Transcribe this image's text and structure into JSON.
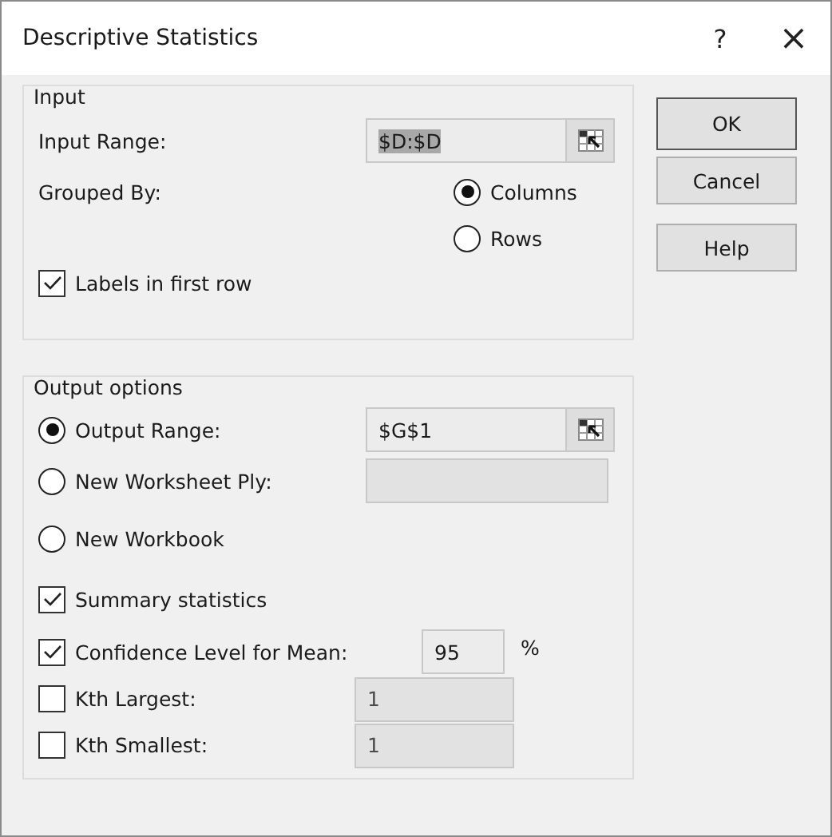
{
  "window": {
    "title": "Descriptive Statistics",
    "help": "?",
    "close": "×"
  },
  "input": {
    "title": "Input",
    "range_label": "Input Range:",
    "range_value": "$D:$D",
    "grouped_label": "Grouped By:",
    "grouping": [
      {
        "label": "Columns",
        "selected": true
      },
      {
        "label": "Rows",
        "selected": false
      }
    ],
    "labels_first_row": {
      "label": "Labels in first row",
      "checked": true
    }
  },
  "output": {
    "title": "Output options",
    "destinations": [
      {
        "label": "Output Range:",
        "selected": true,
        "kind": "range",
        "value": "$G$1"
      },
      {
        "label": "New Worksheet Ply:",
        "selected": false,
        "kind": "text"
      },
      {
        "label": "New Workbook",
        "selected": false,
        "kind": "none"
      }
    ],
    "options": [
      {
        "label": "Summary statistics",
        "checked": true,
        "kind": "plain"
      },
      {
        "label": "Confidence Level for Mean:",
        "checked": true,
        "kind": "percent",
        "value": "95",
        "unit": "%"
      },
      {
        "label": "Kth Largest:",
        "checked": false,
        "kind": "number",
        "value": "1"
      },
      {
        "label": "Kth Smallest:",
        "checked": false,
        "kind": "number",
        "value": "1"
      }
    ]
  },
  "buttons": [
    {
      "label": "OK",
      "default": true
    },
    {
      "label": "Cancel",
      "default": false
    },
    {
      "label": "Help",
      "default": false
    }
  ]
}
